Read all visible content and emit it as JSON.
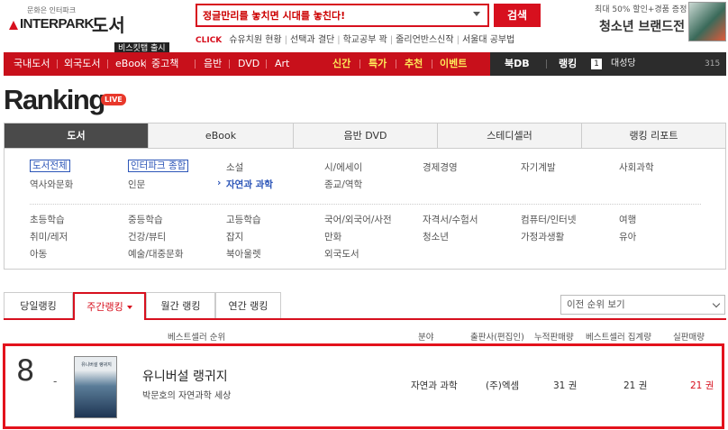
{
  "header": {
    "logo_slogan": "문화은 인터파크",
    "logo_word": "INTERPARK",
    "logo_sub": "도서",
    "search_value": "정글만리를 놓치면 시대를 놓친다!",
    "search_button": "검색",
    "click_label": "CLICK",
    "click_keywords": [
      "슈유치원 현황",
      "선택과 결단",
      "학교공부 꽉",
      "줄리언반스신작",
      "서울대 공부법"
    ],
    "promo_small": "최대 50% 할인+경품 증정",
    "promo_big": "청소년 브랜드전"
  },
  "nav": {
    "badge": "비스킷탭 출시",
    "items": [
      "국내도서",
      "외국도서",
      "eBook",
      "중고책",
      "음반",
      "DVD",
      "Art"
    ],
    "special": [
      "신간",
      "특가",
      "추천",
      "이벤트"
    ],
    "dark": [
      "북DB",
      "랭킹"
    ],
    "rank_number": "1",
    "rank_name": "대성당",
    "rank_count": "315"
  },
  "page": {
    "title": "Ranking",
    "live_badge": "LIVE"
  },
  "category_tabs": [
    "도서",
    "eBook",
    "음반 DVD",
    "스테디셀러",
    "랭킹 리포트"
  ],
  "categories": {
    "all": "도서전체",
    "interpark": "인터파크 종합",
    "links": [
      "소설",
      "시/에세이",
      "경제경영",
      "자기계발",
      "사회과학",
      "역사와문화",
      "인문",
      "자연과 과학",
      "종교/역학",
      "초등학습",
      "중등학습",
      "고등학습",
      "국어/외국어/사전",
      "자격서/수험서",
      "컴퓨터/인터넷",
      "여행",
      "취미/레저",
      "건강/뷰티",
      "잡지",
      "만화",
      "청소년",
      "가정과생활",
      "유아",
      "아동",
      "예술/대중문화",
      "북아울렛",
      "외국도서"
    ],
    "selected_marker": "›"
  },
  "period_tabs": [
    "당일랭킹",
    "주간랭킹",
    "월간 랭킹",
    "연간 랭킹"
  ],
  "prev_select": "이전 순위 보기",
  "table": {
    "headers": [
      "베스트셀러 순위",
      "분야",
      "출판사(편집인)",
      "누적판매량",
      "베스트셀러 집계량",
      "실판매량"
    ]
  },
  "row": {
    "rank": "8",
    "change": "-",
    "cover_text": "유니버설 랭귀지",
    "title": "유니버설 랭귀지",
    "subtitle": "박문호의 자연과학 세상",
    "field": "자연과 과학",
    "publisher": "(주)엑셈",
    "cumulative": "31 권",
    "bestseller_count": "21 권",
    "actual_sales": "21 권"
  },
  "colors": {
    "brand_red": "#d7101e",
    "nav_red": "#c8101b",
    "nav_dark": "#2c2c2c",
    "link_blue": "#2d56b8"
  }
}
